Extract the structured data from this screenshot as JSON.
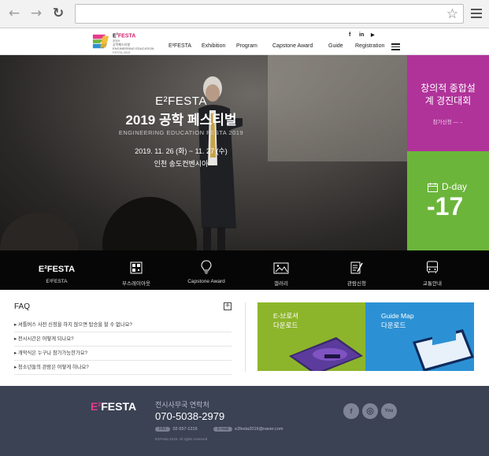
{
  "browser": {
    "back_glyph": "←",
    "forward_glyph": "→",
    "reload_glyph": "↻",
    "url": "",
    "star_glyph": "☆"
  },
  "header": {
    "logo": {
      "mark": "E",
      "title_prefix": "E",
      "title_sup": "2",
      "title_rest": "FESTA",
      "year": "2019",
      "korean": "공학페스티벌",
      "english": "ENGINEERING EDUCATION",
      "sub": "FESTA 2019"
    },
    "social": [
      "f",
      "in",
      "▶"
    ],
    "nav": [
      "E²FESTA",
      "Exhibition",
      "Program",
      "Capstone Award",
      "Guide",
      "Registration"
    ]
  },
  "hero": {
    "title1": "E²FESTA",
    "title2": "2019 공학 페스티벌",
    "title3": "ENGINEERING EDUCATION FESTA 2019",
    "date": "2019. 11. 26 (화) ~ 11. 27 (수)",
    "venue": "인천 송도컨벤시아"
  },
  "side": {
    "contest_title": "창의적 종합설계 경진대회",
    "contest_link": "참가신청 —→",
    "dday_label": "D-day",
    "dday_value": "-17",
    "colors": {
      "pink": "#b0339a",
      "green": "#6bb53b"
    }
  },
  "quick_links": [
    {
      "label": "E²FESTA",
      "icon": "efesta-logo-icon",
      "symbol": "E²FESTA"
    },
    {
      "label": "부스레이아웃",
      "icon": "qr-layout-icon"
    },
    {
      "label": "Capstone Award",
      "icon": "lightbulb-icon"
    },
    {
      "label": "갤러리",
      "icon": "image-gallery-icon"
    },
    {
      "label": "관람신청",
      "icon": "form-pen-icon"
    },
    {
      "label": "교통안내",
      "icon": "bus-icon"
    }
  ],
  "faq": {
    "title": "FAQ",
    "plus": "+",
    "items": [
      "셔틀버스 사전 신청을 하지 않으면 탑승을 할 수 없나요?",
      "전시시간은 어떻게 되나요?",
      "개막식은 누구나 참가가능한가요?",
      "청소년들의 관람은 어떻게 하나요?"
    ]
  },
  "banners": {
    "brochure": "E-브로셔\n다운로드",
    "brochure_line1": "E-브로셔",
    "brochure_line2": "다운로드",
    "guide_line1": "Guide Map",
    "guide_line2": "다운로드"
  },
  "footer": {
    "logo_prefix": "E",
    "logo_sup": "2",
    "logo_rest": "FESTA",
    "label": "전시사무국 연락처",
    "phone": "070-5038-2979",
    "fax_label": "FAX",
    "fax": "02-557-1216",
    "email_label": "E-mail",
    "email": "e2festa2019@naver.com",
    "copyright": "E2Festa 2019. All rights reserved",
    "sns": [
      "f",
      "◎",
      "You"
    ]
  }
}
